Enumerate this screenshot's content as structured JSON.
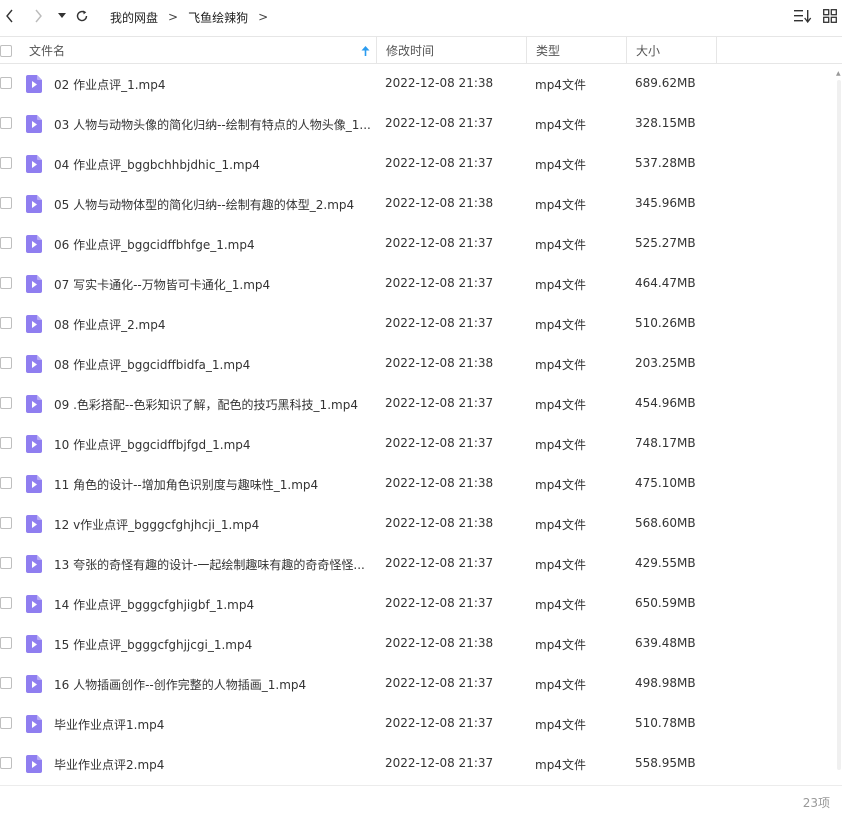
{
  "toolbar": {
    "breadcrumb": [
      "我的网盘",
      "飞鱼绘辣狗"
    ],
    "separator": ">"
  },
  "columns": {
    "name": "文件名",
    "modified": "修改时间",
    "type": "类型",
    "size": "大小"
  },
  "files": [
    {
      "name": "02 作业点评_1.mp4",
      "time": "2022-12-08 21:38",
      "type": "mp4文件",
      "size": "689.62MB"
    },
    {
      "name": "03 人物与动物头像的简化归纳--绘制有特点的人物头像_1...",
      "time": "2022-12-08 21:37",
      "type": "mp4文件",
      "size": "328.15MB"
    },
    {
      "name": "04 作业点评_bggbchhbjdhic_1.mp4",
      "time": "2022-12-08 21:37",
      "type": "mp4文件",
      "size": "537.28MB"
    },
    {
      "name": "05 人物与动物体型的简化归纳--绘制有趣的体型_2.mp4",
      "time": "2022-12-08 21:38",
      "type": "mp4文件",
      "size": "345.96MB"
    },
    {
      "name": "06 作业点评_bggcidffbhfge_1.mp4",
      "time": "2022-12-08 21:37",
      "type": "mp4文件",
      "size": "525.27MB"
    },
    {
      "name": "07 写实卡通化--万物皆可卡通化_1.mp4",
      "time": "2022-12-08 21:37",
      "type": "mp4文件",
      "size": "464.47MB"
    },
    {
      "name": "08 作业点评_2.mp4",
      "time": "2022-12-08 21:37",
      "type": "mp4文件",
      "size": "510.26MB"
    },
    {
      "name": "08 作业点评_bggcidffbidfa_1.mp4",
      "time": "2022-12-08 21:38",
      "type": "mp4文件",
      "size": "203.25MB"
    },
    {
      "name": "09 .色彩搭配--色彩知识了解，配色的技巧黑科技_1.mp4",
      "time": "2022-12-08 21:37",
      "type": "mp4文件",
      "size": "454.96MB"
    },
    {
      "name": "10 作业点评_bggcidffbjfgd_1.mp4",
      "time": "2022-12-08 21:37",
      "type": "mp4文件",
      "size": "748.17MB"
    },
    {
      "name": "11 角色的设计--增加角色识别度与趣味性_1.mp4",
      "time": "2022-12-08 21:38",
      "type": "mp4文件",
      "size": "475.10MB"
    },
    {
      "name": "12 v作业点评_bgggcfghjhcji_1.mp4",
      "time": "2022-12-08 21:38",
      "type": "mp4文件",
      "size": "568.60MB"
    },
    {
      "name": "13 夸张的奇怪有趣的设计-一起绘制趣味有趣的奇奇怪怪...",
      "time": "2022-12-08 21:37",
      "type": "mp4文件",
      "size": "429.55MB"
    },
    {
      "name": "14 作业点评_bgggcfghjigbf_1.mp4",
      "time": "2022-12-08 21:37",
      "type": "mp4文件",
      "size": "650.59MB"
    },
    {
      "name": "15 作业点评_bgggcfghjjcgi_1.mp4",
      "time": "2022-12-08 21:38",
      "type": "mp4文件",
      "size": "639.48MB"
    },
    {
      "name": "16 人物插画创作--创作完整的人物插画_1.mp4",
      "time": "2022-12-08 21:37",
      "type": "mp4文件",
      "size": "498.98MB"
    },
    {
      "name": "毕业作业点评1.mp4",
      "time": "2022-12-08 21:37",
      "type": "mp4文件",
      "size": "510.78MB"
    },
    {
      "name": "毕业作业点评2.mp4",
      "time": "2022-12-08 21:37",
      "type": "mp4文件",
      "size": "558.95MB"
    }
  ],
  "footer": {
    "count": "23项"
  },
  "colors": {
    "file_icon": "#8f7ef0",
    "sort_arrow": "#2b9cf0"
  }
}
